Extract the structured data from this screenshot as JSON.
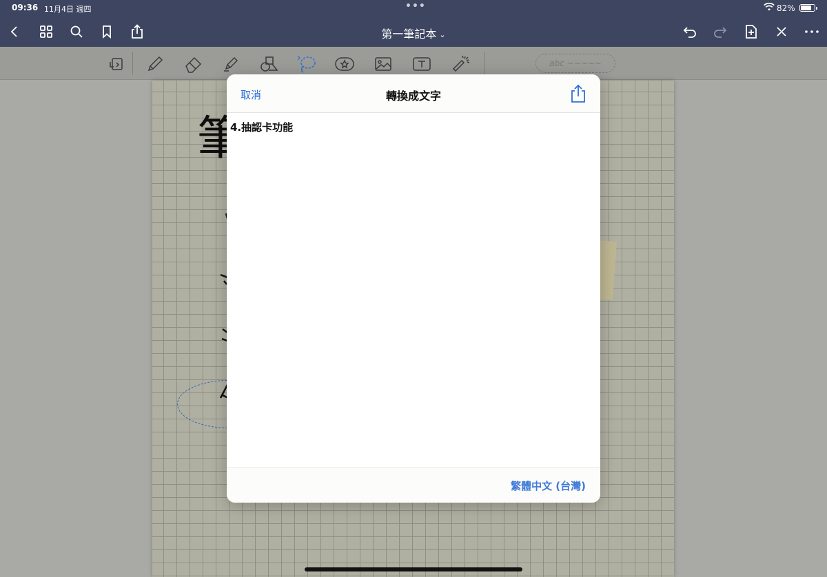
{
  "status_bar": {
    "time": "09:36",
    "date": "11月4日 週四",
    "battery_percent": "82%",
    "battery_level": 0.82
  },
  "nav": {
    "title": "第一筆記本",
    "title_chevron": "⌄",
    "left_icons": [
      "back-chevron-icon",
      "grid-icon",
      "search-icon",
      "bookmark-icon",
      "share-icon"
    ],
    "right_icons": [
      "undo-icon",
      "redo-icon",
      "add-page-icon",
      "close-x-icon",
      "more-icon"
    ]
  },
  "toolbar": {
    "tools": [
      "page-switch-icon",
      "pen-icon",
      "eraser-icon",
      "highlighter-icon",
      "shapes-icon",
      "lasso-icon",
      "sticker-icon",
      "image-icon",
      "text-box-icon",
      "laser-pointer-icon"
    ],
    "handwriting_pill": "abc ~~~~~"
  },
  "notebook": {
    "handwriting_title_glyph": "筆"
  },
  "dialog": {
    "cancel_label": "取消",
    "title": "轉換成文字",
    "converted_text": "4.抽認卡功能",
    "language_label": "繁體中文 (台灣)",
    "accent_color": "#2f6fd6"
  }
}
